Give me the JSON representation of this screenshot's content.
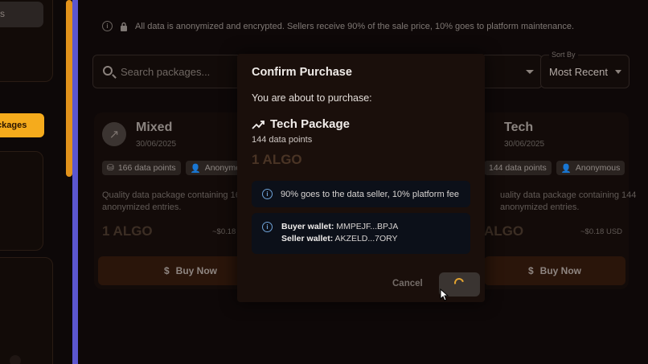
{
  "sidebar": {
    "top_item_label": "s",
    "packages_label": "ckages"
  },
  "notice": {
    "text": "All data is anonymized and encrypted. Sellers receive 90% of the sale price, 10% goes to platform maintenance."
  },
  "search": {
    "placeholder": "Search packages..."
  },
  "sort": {
    "label": "Sort By",
    "value": "Most Recent"
  },
  "cards": [
    {
      "name": "Mixed",
      "date": "30/06/2025",
      "points": "166 data points",
      "author": "Anonymou",
      "description": "Quality data package containing 16",
      "description2": "anonymized entries.",
      "price": "1 ALGO",
      "usd": "~$0.18",
      "buy_label": "Buy Now"
    },
    {
      "name": "Tech",
      "date": "30/06/2025",
      "points": "144 data points",
      "author": "Anonymous",
      "description": "uality data package containing 144",
      "description2": "anonymized entries.",
      "price": "ALGO",
      "usd": "~$0.18 USD",
      "buy_label": "Buy Now"
    }
  ],
  "modal": {
    "title": "Confirm Purchase",
    "subtitle": "You are about to purchase:",
    "package_name": "Tech Package",
    "points": "144 data points",
    "price": "1 ALGO",
    "fee_note": "90% goes to the data seller, 10% platform fee",
    "buyer_label": "Buyer wallet:",
    "buyer_value": "MMPEJF...BPJA",
    "seller_label": "Seller wallet:",
    "seller_value": "AKZELD...7ORY",
    "cancel_label": "Cancel"
  },
  "colors": {
    "accent_orange": "#f5ab1c",
    "accent_purple": "#5b56cf",
    "info_blue": "#6fa3d8"
  }
}
